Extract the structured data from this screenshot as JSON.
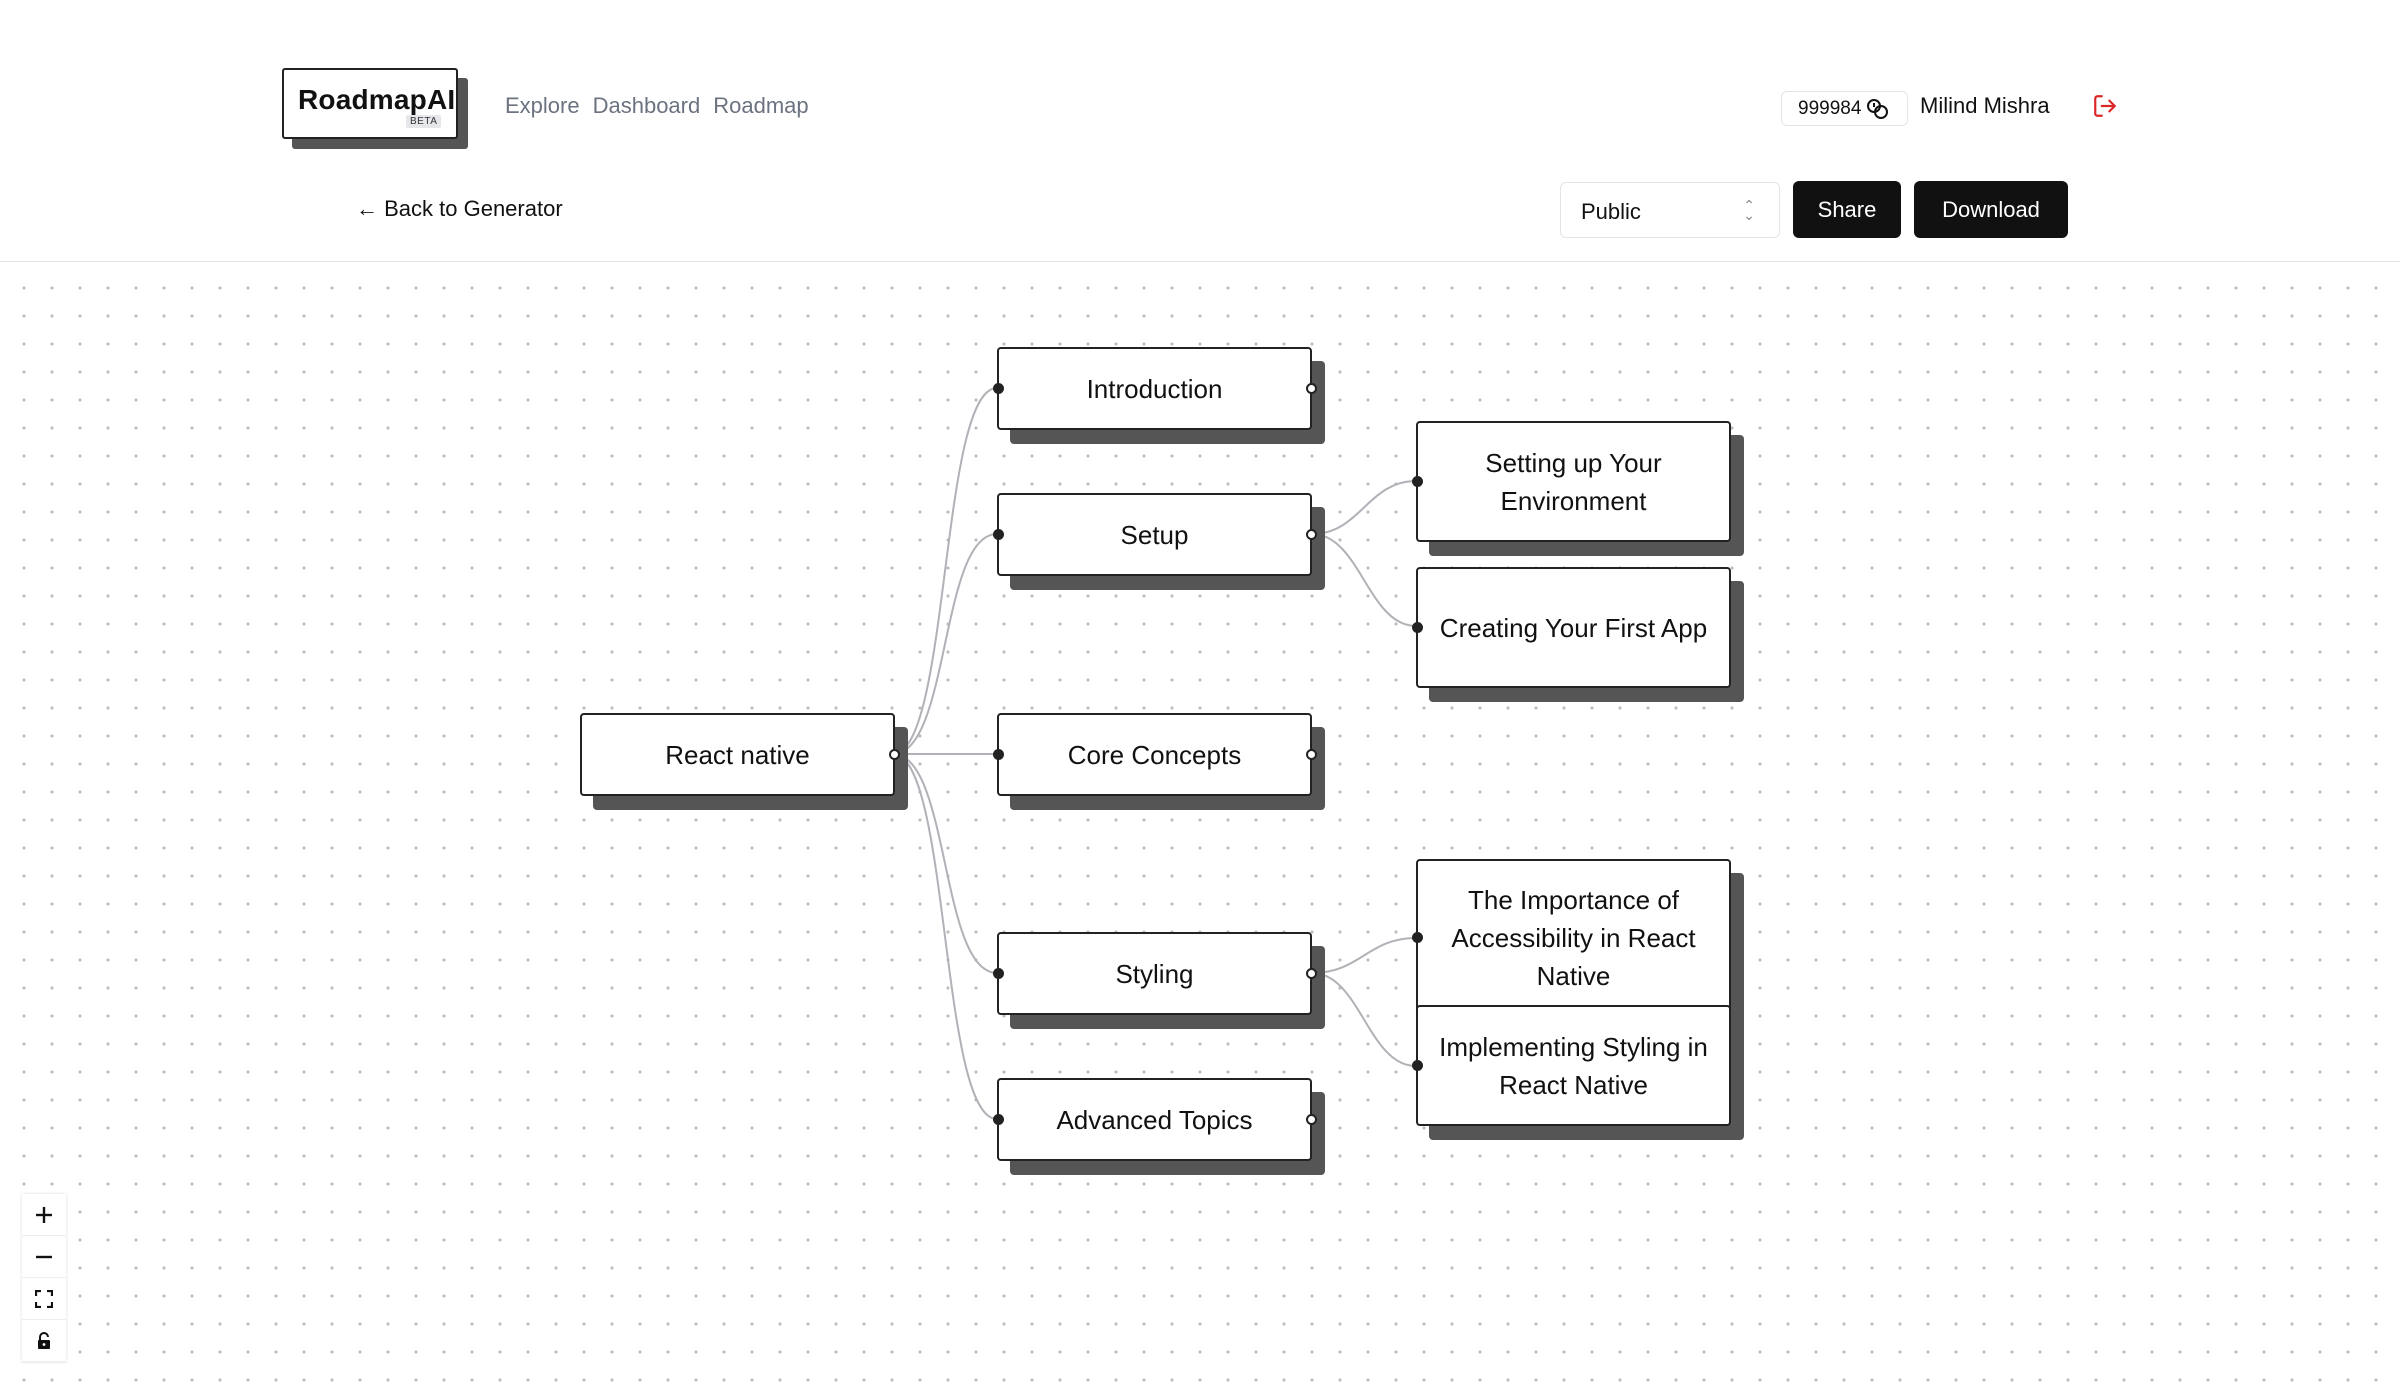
{
  "header": {
    "logo": {
      "name": "RoadmapAI",
      "badge": "BETA"
    },
    "nav": [
      "Explore",
      "Dashboard",
      "Roadmap"
    ],
    "credits": "999984",
    "user_name": "Milind Mishra"
  },
  "toolbar": {
    "back_label": "← Back to Generator",
    "visibility": "Public",
    "share_label": "Share",
    "download_label": "Download"
  },
  "roadmap": {
    "root": "React native",
    "topics": [
      "Introduction",
      "Setup",
      "Core Concepts",
      "Styling",
      "Advanced Topics"
    ],
    "subtopics": {
      "Setup": [
        "Setting up Your Environment",
        "Creating Your First App"
      ],
      "Styling": [
        "The Importance of Accessibility in React Native",
        "Implementing Styling in React Native"
      ]
    }
  },
  "controls": [
    "zoom-in",
    "zoom-out",
    "fit-view",
    "lock"
  ],
  "colors": {
    "accent": "#111111",
    "logout": "#dc2626",
    "shadow": "#555555",
    "edge": "#b1b1b7"
  }
}
